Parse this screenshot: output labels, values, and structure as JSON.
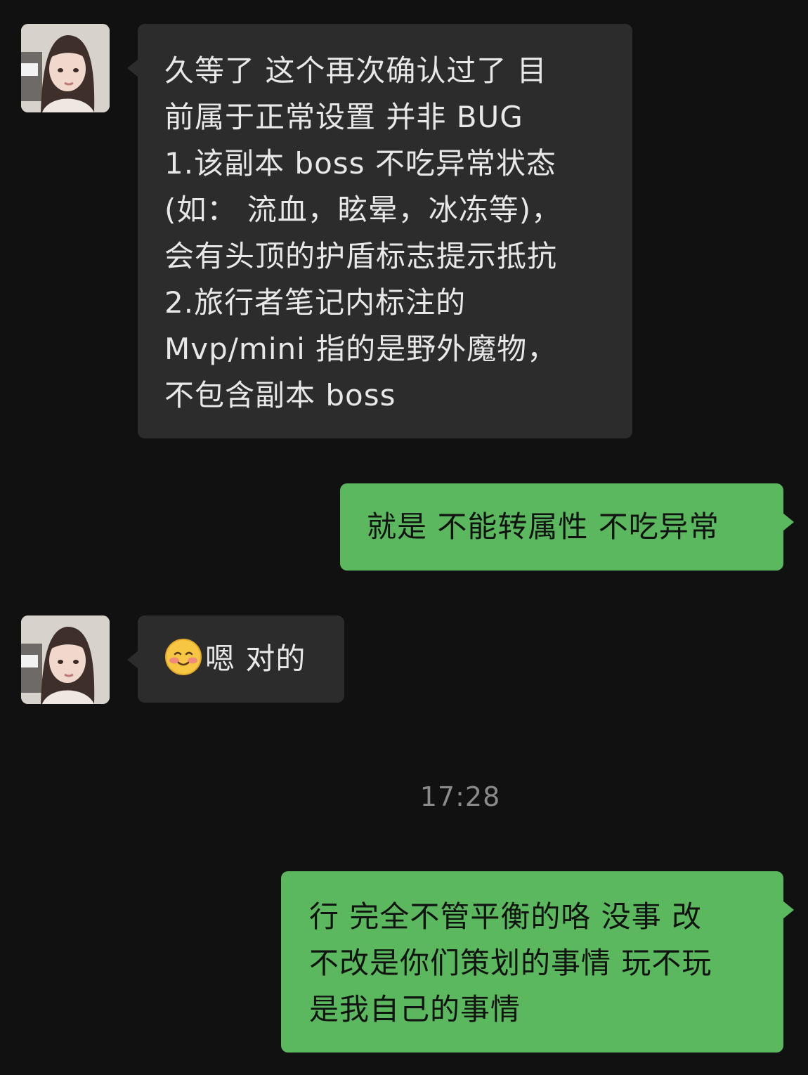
{
  "chat": {
    "messages": [
      {
        "sender": "other",
        "lines": [
          "久等了 这个再次确认过了 目",
          "前属于正常设置  并非 BUG",
          "1.该副本 boss 不吃异常状态",
          "(如：  流血，眩晕，冰冻等)，",
          "会有头顶的护盾标志提示抵抗",
          "2.旅行者笔记内标注的",
          "Mvp/mini 指的是野外魔物，",
          "不包含副本 boss"
        ]
      },
      {
        "sender": "me",
        "lines": [
          "就是 不能转属性 不吃异常"
        ]
      },
      {
        "sender": "other",
        "emoji": "blushing-face",
        "lines": [
          "嗯 对的"
        ]
      },
      {
        "sender": "me",
        "lines": [
          "行 完全不管平衡的咯 没事 改",
          "不改是你们策划的事情 玩不玩",
          "是我自己的事情"
        ]
      }
    ],
    "timestamp": "17:28"
  },
  "colors": {
    "background": "#111111",
    "incoming_bubble": "#2c2c2c",
    "outgoing_bubble": "#5cb85f",
    "timestamp_text": "#8a8a8a"
  }
}
